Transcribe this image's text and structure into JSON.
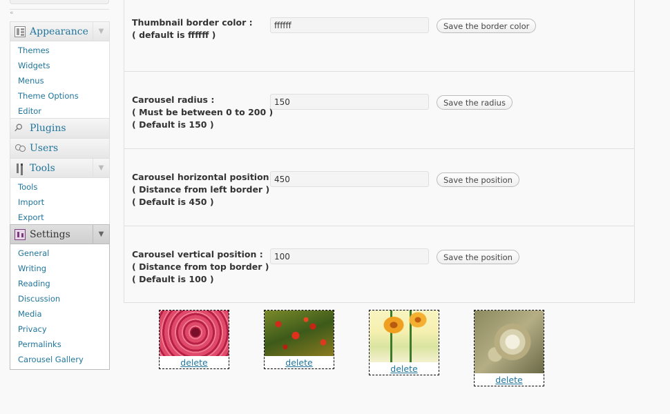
{
  "sidebar": {
    "collapse_glyph": "«",
    "appearance": {
      "title": "Appearance",
      "icon": "appearance-icon",
      "items": [
        "Themes",
        "Widgets",
        "Menus",
        "Theme Options",
        "Editor"
      ]
    },
    "plugins": {
      "title": "Plugins",
      "icon": "plugin-icon"
    },
    "users": {
      "title": "Users",
      "icon": "users-icon"
    },
    "tools": {
      "title": "Tools",
      "icon": "tools-icon",
      "items": [
        "Tools",
        "Import",
        "Export"
      ]
    },
    "settings": {
      "title": "Settings",
      "icon": "settings-icon",
      "items": [
        "General",
        "Writing",
        "Reading",
        "Discussion",
        "Media",
        "Privacy",
        "Permalinks",
        "Carousel Gallery"
      ]
    },
    "arrow_glyph": "▼"
  },
  "options": [
    {
      "label": "Thumbnail border color :\n( default is ffffff )",
      "value": "ffffff",
      "button": "Save the border color"
    },
    {
      "label": "Carousel radius :\n( Must be between 0 to 200 )\n( Default is 150 )",
      "value": "150",
      "button": "Save the radius"
    },
    {
      "label": "Carousel horizontal position :\n( Distance from left border )\n( Default is 450 )",
      "value": "450",
      "button": "Save the position"
    },
    {
      "label": "Carousel vertical position :\n( Distance from top border )\n( Default is 100 )",
      "value": "100",
      "button": "Save the position"
    }
  ],
  "thumbnails": [
    {
      "image": "pink-rose",
      "delete_label": "delete"
    },
    {
      "image": "red-poppy-field",
      "delete_label": "delete"
    },
    {
      "image": "orange-gerbera",
      "delete_label": "delete"
    },
    {
      "image": "white-chrysanthemum",
      "delete_label": "delete"
    }
  ],
  "colors": {
    "link": "#21759b",
    "border": "#dfdfdf",
    "background": "#f9f9f9"
  }
}
